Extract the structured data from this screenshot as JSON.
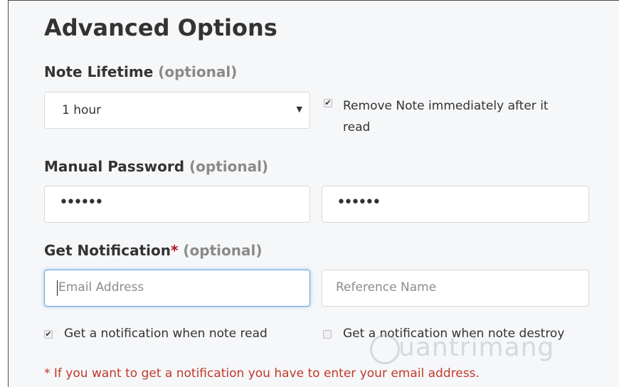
{
  "heading": "Advanced Options",
  "lifetime": {
    "label": "Note Lifetime",
    "optional": "(optional)",
    "select_value": "1 hour",
    "arrow": "▼",
    "remove_checkbox_line1": "Remove Note immediately after it",
    "remove_checkbox_line2": "read",
    "remove_checked": true
  },
  "password": {
    "label": "Manual Password",
    "optional": "(optional)",
    "value1": "••••••",
    "value2": "••••••"
  },
  "notification": {
    "label": "Get Notification",
    "required_mark": "*",
    "optional": "(optional)",
    "email_placeholder": "Email Address",
    "reference_placeholder": "Reference Name",
    "on_read_label": "Get a notification when note read",
    "on_read_checked": true,
    "on_destroy_label": "Get a notification when note destroy",
    "on_destroy_checked": false,
    "check_mark": "✔",
    "note": "* If you want to get a notification you have to enter your email address."
  },
  "watermark": "uantrimang"
}
